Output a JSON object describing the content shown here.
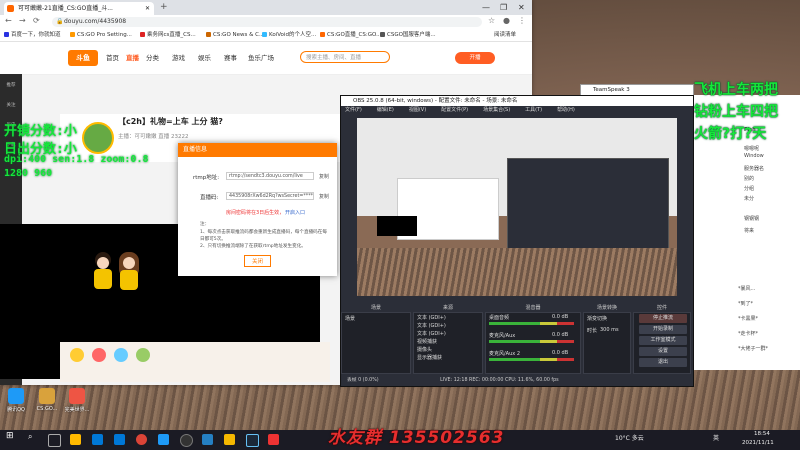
{
  "browser": {
    "tab_title": "可可嫩嫩-21直播_CS:GO直播_斗...",
    "url": "douyu.com/4435908",
    "bookmarks": [
      "百度一下，你就知道",
      "CS:GO Pro Setting...",
      "乘务网cs直播_CS...",
      "CS:GO News & C...",
      "KoiVoid的个人空...",
      "CS:GO直播_CS:GO...",
      "CSGO国服客户端..."
    ],
    "reading_list": "阅读清单"
  },
  "douyu": {
    "logo": "斗鱼",
    "nav": [
      "首页",
      "直播",
      "分类",
      "游戏",
      "娱乐",
      "赛事",
      "鱼乐广场"
    ],
    "active_nav": "直播",
    "search_placeholder": "搜索主播、房间、直播",
    "start_button": "开播",
    "room_title": "【c2h】礼物=上车 上分 猫?",
    "room_meta": "主播：可可嫩嫩  直播  23222",
    "left_items": [
      "推荐",
      "关注",
      "历史",
      "下载"
    ]
  },
  "modal": {
    "title": "直播信息",
    "rtmp_label": "rtmp地址:",
    "rtmp_value": "rtmp://sendtc3.douyu.com/live",
    "code_label": "直播码:",
    "code_value": "4435908rXw6d2Rq?wsSecret=******",
    "copy": "复制",
    "warning": "房间密码将在3日后生效，",
    "warning_link": "开启入口",
    "note_heading": "注：",
    "note_1": "1、每次点击获取推流码都会重新生成直播码，每个直播码在每日都可5次。",
    "note_2": "2、只有切换推流端除了在获取rtmp地址发生变化。",
    "close": "关闭"
  },
  "overlay": {
    "left_line1": "开镜分数:小",
    "left_line2": "日出分数:小",
    "left_line3": "dpi:400 sen:1.8 zoom:0.8",
    "left_line4": "1280 960",
    "right_line1": "飞机上车两把",
    "right_line2": "钻粉上车四把",
    "right_line3": "火箭?打?天",
    "qq_group": "水友群 135502563"
  },
  "obs": {
    "title": "OBS 25.0.8 (64-bit, windows) - 配置文件: 未命名 - 场景: 未命名",
    "menu": [
      "文件(F)",
      "编辑(E)",
      "视图(V)",
      "配置文件(P)",
      "场景集合(S)",
      "工具(T)",
      "帮助(H)"
    ],
    "docks": [
      "场景",
      "来源",
      "混音器",
      "场景转换",
      "控件"
    ],
    "scene": "场景",
    "sources": [
      "文本 (GDI+)",
      "文本 (GDI+)",
      "文本 (GDI+)",
      "视频捕获",
      "摄像头",
      "显示器捕获"
    ],
    "mixer": [
      {
        "name": "桌面音频",
        "value": "0.0 dB"
      },
      {
        "name": "麦克风/Aux",
        "value": "0.0 dB"
      },
      {
        "name": "麦克风/Aux 2",
        "value": "0.0 dB"
      }
    ],
    "transition": "渐变切换",
    "transition_duration_label": "时长",
    "transition_duration": "300 ms",
    "controls": [
      "停止推流",
      "开始录制",
      "工作室模式",
      "设置",
      "退出"
    ],
    "status": "LIVE: 12:18  REC: 00:00:00  CPU: 11.6%, 60.00 fps",
    "dropped": "丢帧 0 (0.0%)"
  },
  "teamspeak": {
    "title": "TeamSpeak 3",
    "users": [
      "Fish",
      "Window",
      "服务器名",
      "别的",
      "分组",
      "未分",
      "钢钢钢",
      "将来"
    ]
  },
  "chat": {
    "lines": [
      "嗯嗯呢",
      "Window",
      "*我当大哥的人",
      "好好好",
      "关注",
      "*好",
      "开启我来了"
    ],
    "bottom_lines": [
      "*暴风...",
      "*到了*",
      "*卡黑果*",
      "*走卡杯*",
      "*大佬子一群*"
    ]
  },
  "desktop_icons": [
    "腾讯QQ",
    "CS:GO...",
    "完美世界..."
  ],
  "taskbar": {
    "weather": "10°C 多云",
    "time": "18:54",
    "date": "2021/11/11",
    "language": "英"
  },
  "colors": {
    "douyu_orange": "#ff7a00",
    "overlay_green": "#15e83a",
    "obs_bg": "#2b2e38",
    "qq_red": "#e62e2e"
  }
}
